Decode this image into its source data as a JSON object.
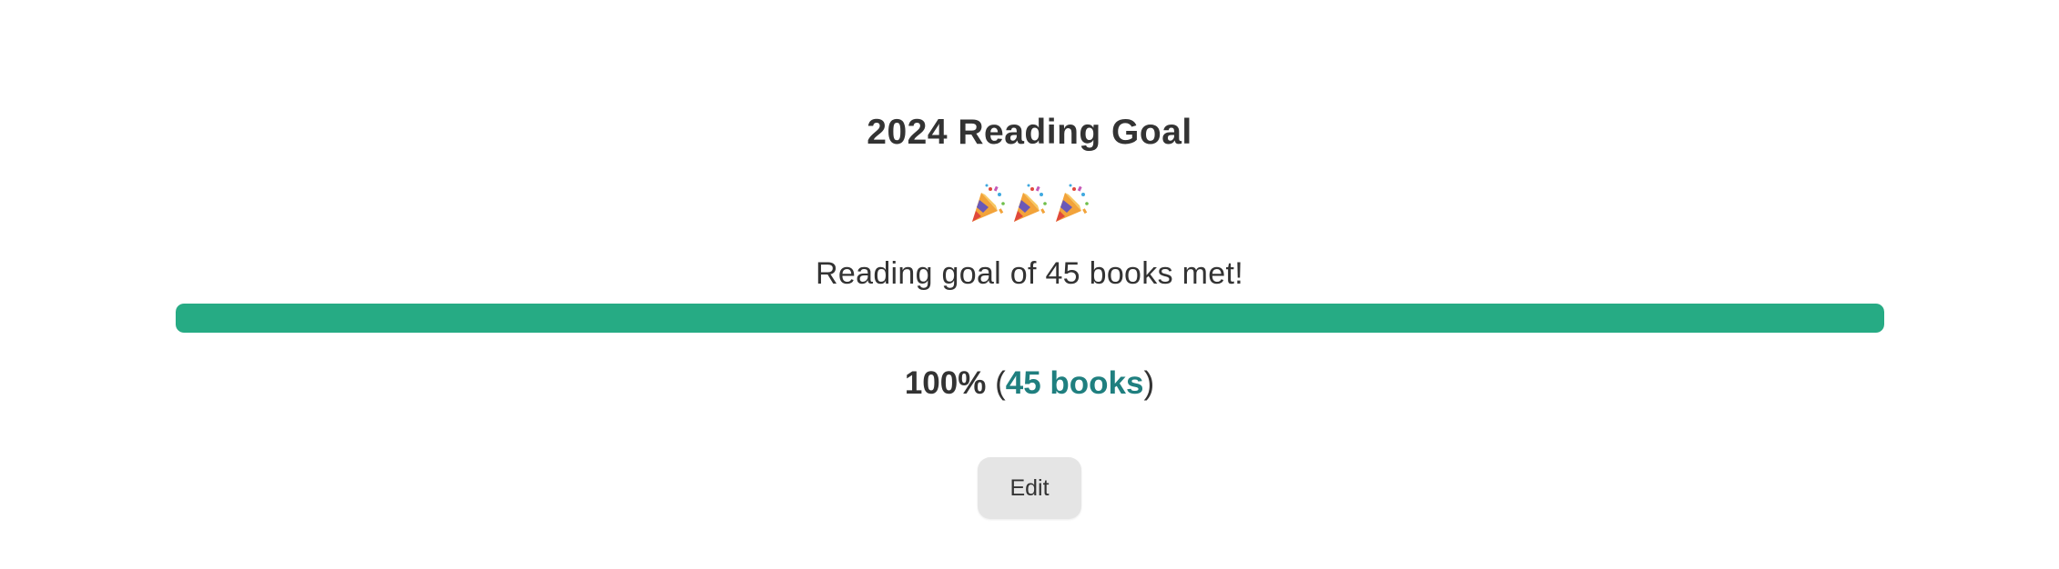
{
  "goal": {
    "title": "2024 Reading Goal",
    "celebration_icons": [
      "party-popper-icon",
      "party-popper-icon",
      "party-popper-icon"
    ],
    "message": "Reading goal of 45 books met!",
    "progress_fraction": 1.0,
    "percent_text": "100%",
    "open_paren": "(",
    "books_text": "45 books",
    "close_paren": ")",
    "edit_label": "Edit"
  },
  "colors": {
    "progress_fill": "#26ab84",
    "books_link": "#1f7f7f",
    "text": "#333333",
    "button_bg": "#e5e5e5"
  }
}
